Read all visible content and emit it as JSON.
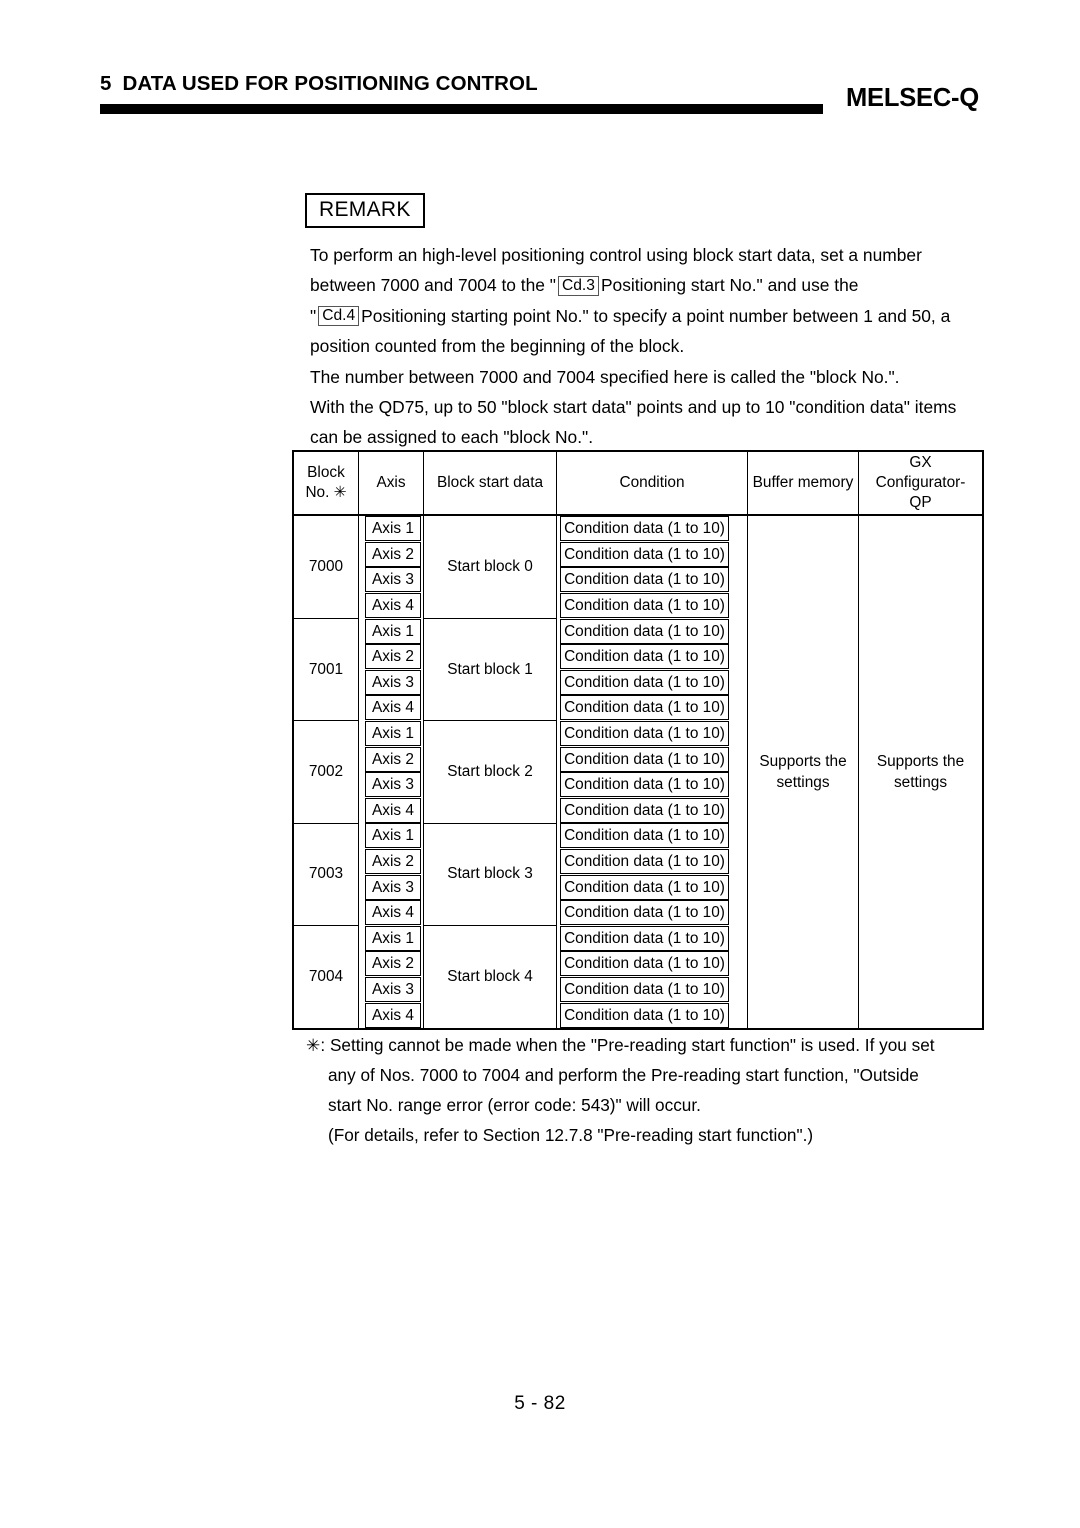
{
  "header": {
    "chapter_number": "5",
    "chapter_title": "DATA USED FOR POSITIONING CONTROL",
    "product": "MELSEC-Q"
  },
  "remark": {
    "label": "REMARK",
    "line1": "To perform an high-level positioning control using block start data, set a number",
    "line2_a": "between 7000 and 7004 to the \"",
    "line2_tag": "Cd.3",
    "line2_b": "Positioning start No.\" and use the",
    "line3_a": "\"",
    "line3_tag": "Cd.4",
    "line3_b": "Positioning starting point No.\" to specify a point number between 1 and 50, a",
    "line4": "position counted from the beginning of the block.",
    "line5": "The number between 7000 and 7004 specified here is called the \"block No.\".",
    "line6": "With the QD75, up to 50 \"block start data\" points and up to 10 \"condition data\" items",
    "line7": "can be assigned to each \"block No.\"."
  },
  "table": {
    "headers": {
      "block_no": "Block\nNo. ✳",
      "block_no_line1": "Block",
      "block_no_line2": "No. ✳",
      "axis": "Axis",
      "block_start_data": "Block start data",
      "condition": "Condition",
      "buffer_memory": "Buffer memory",
      "gx_line1": "GX",
      "gx_line2": "Configurator-",
      "gx_line3": "QP"
    },
    "condition_data_label": "Condition data (1 to 10)",
    "buffer_memory_value": "Supports the settings",
    "buffer_memory_value_l1": "Supports the",
    "buffer_memory_value_l2": "settings",
    "gx_value_l1": "Supports the",
    "gx_value_l2": "settings",
    "groups": [
      {
        "block_no": "7000",
        "block_start_data": "Start block 0",
        "rows": [
          {
            "axis": "Axis 1",
            "condition": "Condition data (1 to 10)"
          },
          {
            "axis": "Axis 2",
            "condition": "Condition data (1 to 10)"
          },
          {
            "axis": "Axis 3",
            "condition": "Condition data (1 to 10)"
          },
          {
            "axis": "Axis 4",
            "condition": "Condition data (1 to 10)"
          }
        ]
      },
      {
        "block_no": "7001",
        "block_start_data": "Start block 1",
        "rows": [
          {
            "axis": "Axis 1",
            "condition": "Condition data (1 to 10)"
          },
          {
            "axis": "Axis 2",
            "condition": "Condition data (1 to 10)"
          },
          {
            "axis": "Axis 3",
            "condition": "Condition data (1 to 10)"
          },
          {
            "axis": "Axis 4",
            "condition": "Condition data (1 to 10)"
          }
        ]
      },
      {
        "block_no": "7002",
        "block_start_data": "Start block 2",
        "rows": [
          {
            "axis": "Axis 1",
            "condition": "Condition data (1 to 10)"
          },
          {
            "axis": "Axis 2",
            "condition": "Condition data (1 to 10)"
          },
          {
            "axis": "Axis 3",
            "condition": "Condition data (1 to 10)"
          },
          {
            "axis": "Axis 4",
            "condition": "Condition data (1 to 10)"
          }
        ]
      },
      {
        "block_no": "7003",
        "block_start_data": "Start block 3",
        "rows": [
          {
            "axis": "Axis 1",
            "condition": "Condition data (1 to 10)"
          },
          {
            "axis": "Axis 2",
            "condition": "Condition data (1 to 10)"
          },
          {
            "axis": "Axis 3",
            "condition": "Condition data (1 to 10)"
          },
          {
            "axis": "Axis 4",
            "condition": "Condition data (1 to 10)"
          }
        ]
      },
      {
        "block_no": "7004",
        "block_start_data": "Start block 4",
        "rows": [
          {
            "axis": "Axis 1",
            "condition": "Condition data (1 to 10)"
          },
          {
            "axis": "Axis 2",
            "condition": "Condition data (1 to 10)"
          },
          {
            "axis": "Axis 3",
            "condition": "Condition data (1 to 10)"
          },
          {
            "axis": "Axis 4",
            "condition": "Condition data (1 to 10)"
          }
        ]
      }
    ]
  },
  "footnote": {
    "marker": "✳:",
    "line1": "Setting cannot be made when the \"Pre-reading start function\" is used. If you set",
    "line2": "any of Nos. 7000 to 7004 and perform the Pre-reading start function, \"Outside",
    "line3": "start No. range error (error code: 543)\" will occur.",
    "line4": "(For details, refer to Section 12.7.8 \"Pre-reading start function\".)"
  },
  "page_number": "5 - 82"
}
